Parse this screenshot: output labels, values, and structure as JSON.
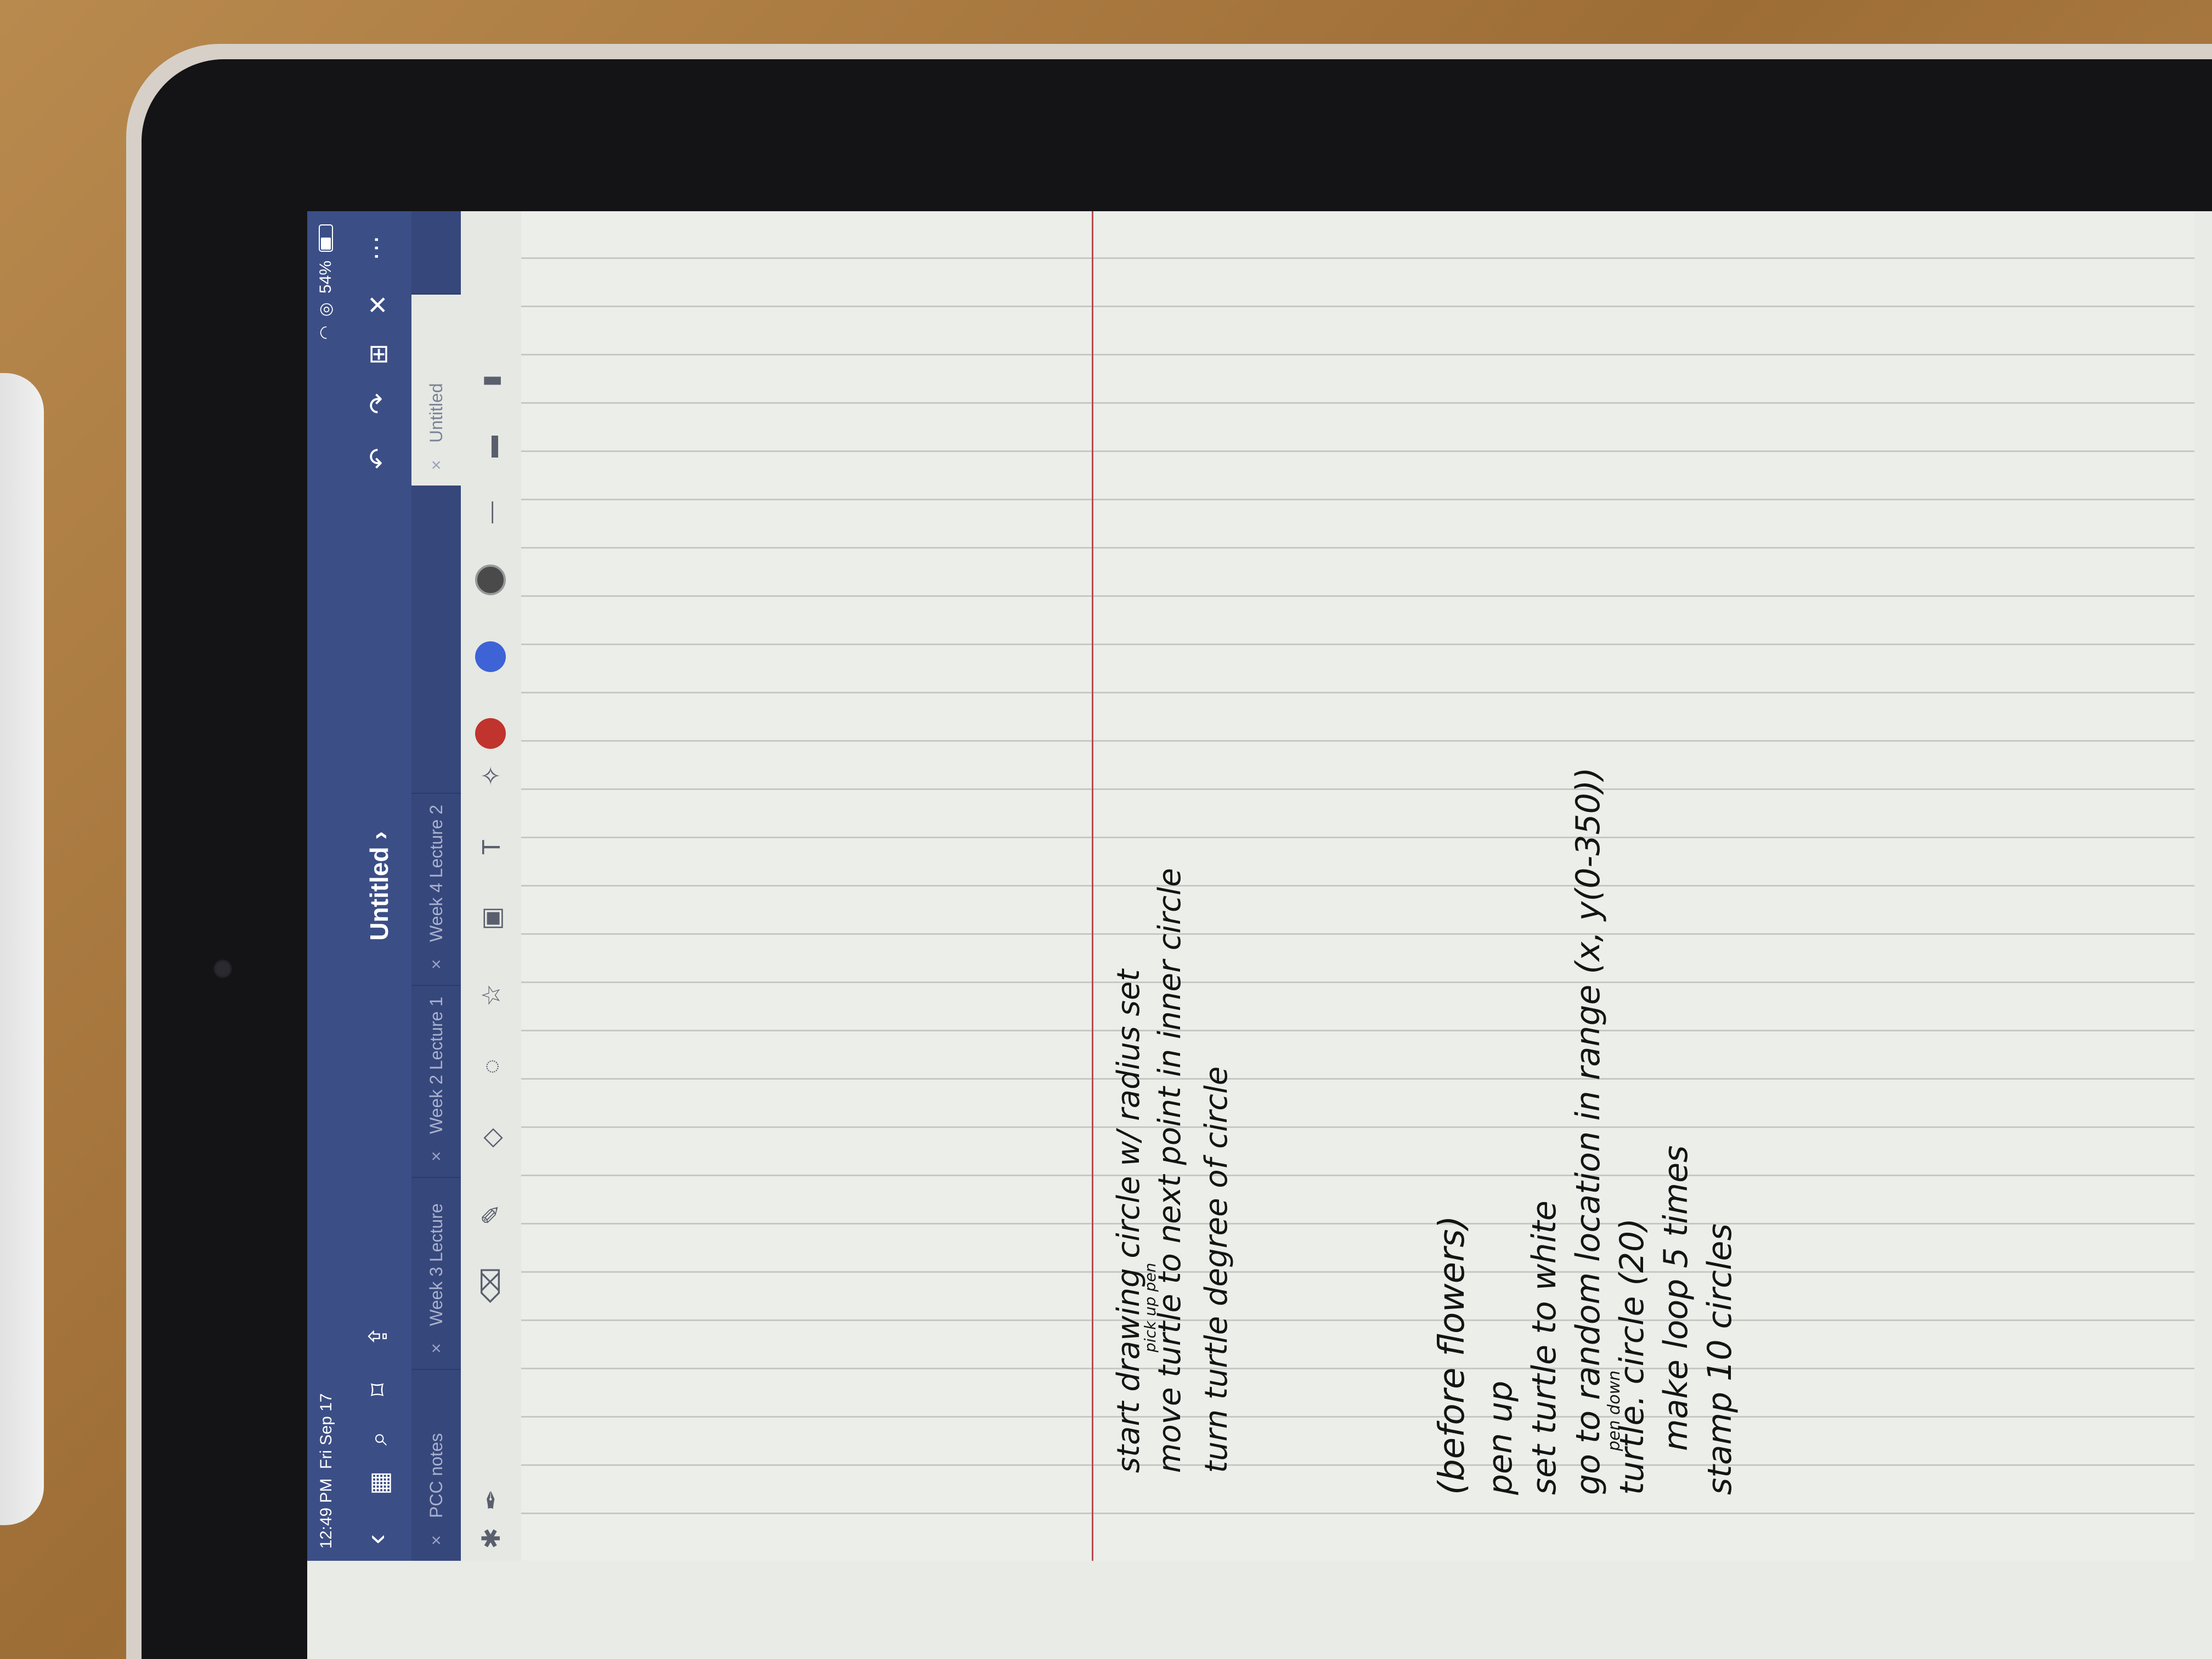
{
  "status_bar": {
    "time": "12:49 PM",
    "date": "Fri Sep 17",
    "battery": "54%"
  },
  "nav_bar": {
    "title": "Untitled ›",
    "icons": [
      "chevron-left-icon",
      "grid-icon",
      "search-icon",
      "bookmark-icon",
      "share-icon",
      "undo-icon",
      "redo-icon",
      "add-page-icon",
      "close-icon",
      "more-icon"
    ]
  },
  "tabs": [
    {
      "label": "PCC notes"
    },
    {
      "label": "Week 3 Lecture"
    },
    {
      "label": "Week 2 Lecture 1"
    },
    {
      "label": "Week 4 Lecture 2"
    },
    {
      "label": "Untitled"
    }
  ],
  "toolbar": {
    "tools": [
      "bluetooth-icon",
      "pen-icon",
      "eraser-icon",
      "highlighter-icon",
      "shapes-icon",
      "lasso-icon",
      "sticker-icon",
      "image-icon",
      "text-icon",
      "laser-icon"
    ],
    "colors": {
      "black": "#1c1c1c",
      "red": "#c0342d",
      "blue": "#3e63d6",
      "gray": "#6a6a6a"
    }
  },
  "notes": {
    "top_block": [
      "start drawing circle w/ radius set",
      "pick up pen",
      "move turtle to next point in inner circle",
      "turn turtle degree of circle"
    ],
    "bottom_block": [
      "(before flowers)",
      "pen up",
      "set turtle to white",
      "go to random location in range (x, y(0-350))",
      "pen down",
      "turtle. circle (20)",
      "make loop 5 times",
      "stamp 10 circles"
    ]
  }
}
